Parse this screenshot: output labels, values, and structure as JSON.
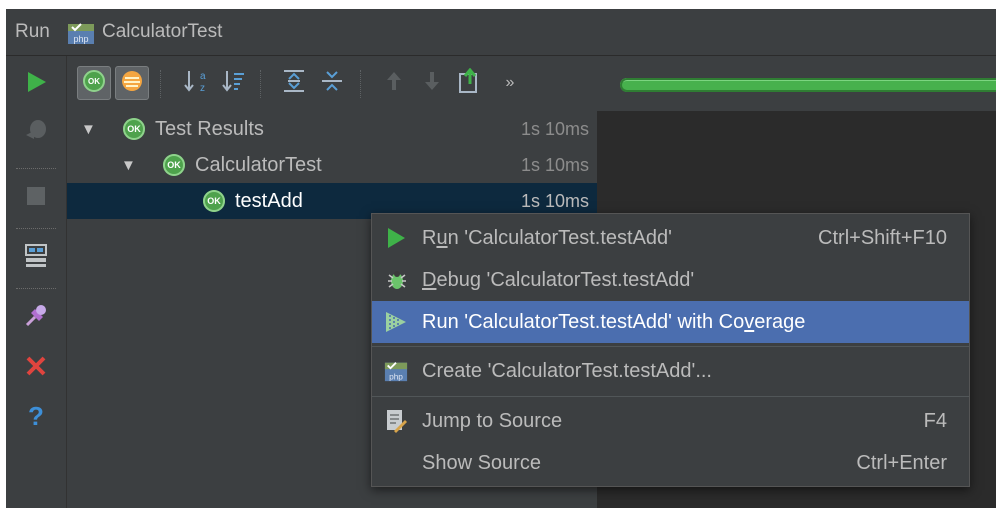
{
  "window": {
    "title_prefix": "Run",
    "title": "CalculatorTest",
    "title_icon": "php-file-icon"
  },
  "left_toolbar": [
    {
      "icon": "run-icon",
      "label": "Rerun"
    },
    {
      "icon": "debug-toggle-icon",
      "label": "Toggle auto-test"
    },
    {
      "icon": "stop-icon",
      "label": "Stop"
    },
    {
      "icon": "layout-icon",
      "label": "Restore layout"
    },
    {
      "icon": "pin-icon",
      "label": "Pin tab"
    },
    {
      "icon": "close-icon",
      "label": "Close"
    },
    {
      "icon": "help-icon",
      "label": "Help"
    }
  ],
  "top_toolbar": [
    {
      "icon": "show-passed-icon",
      "pressed": true
    },
    {
      "icon": "show-ignored-icon",
      "pressed": true
    },
    {
      "icon": "sort-alpha-icon"
    },
    {
      "icon": "sort-duration-icon"
    },
    {
      "icon": "expand-all-icon"
    },
    {
      "icon": "collapse-all-icon"
    },
    {
      "icon": "arrow-up-icon"
    },
    {
      "icon": "arrow-down-icon"
    },
    {
      "icon": "export-icon"
    },
    {
      "icon": "more-icon",
      "text": "»"
    }
  ],
  "progress": {
    "value": 1.0,
    "color": "#47b14d"
  },
  "tree": [
    {
      "label": "Test Results",
      "time": "1s 10ms",
      "level": 0,
      "expanded": true,
      "status": "OK"
    },
    {
      "label": "CalculatorTest",
      "time": "1s 10ms",
      "level": 1,
      "expanded": true,
      "status": "OK"
    },
    {
      "label": "testAdd",
      "time": "1s 10ms",
      "level": 2,
      "selected": true,
      "status": "OK"
    }
  ],
  "context_menu": {
    "items": [
      {
        "pre": "R",
        "mnemonic": "u",
        "post": "n 'CalculatorTest.testAdd'",
        "shortcut": "Ctrl+Shift+F10",
        "icon": "run-icon"
      },
      {
        "pre": "",
        "mnemonic": "D",
        "post": "ebug 'CalculatorTest.testAdd'",
        "shortcut": "",
        "icon": "debug-icon"
      },
      {
        "pre": "Run 'CalculatorTest.testAdd' with Co",
        "mnemonic": "v",
        "post": "erage",
        "shortcut": "",
        "icon": "coverage-icon",
        "highlighted": true
      },
      {
        "pre": "Create 'CalculatorTest.testAdd'...",
        "mnemonic": "",
        "post": "",
        "shortcut": "",
        "icon": "php-create-icon"
      },
      {
        "pre": "Jump to Source",
        "mnemonic": "",
        "post": "",
        "shortcut": "F4",
        "icon": "jump-to-source-icon"
      },
      {
        "pre": "Show Source",
        "mnemonic": "",
        "post": "",
        "shortcut": "Ctrl+Enter",
        "icon": ""
      }
    ]
  },
  "colors": {
    "background": "#2b2b2b",
    "panel": "#3c3f41",
    "selection": "#0d293e",
    "menu_highlight": "#4b6eaf",
    "ok_green": "#4ea24c",
    "run_green": "#3fb249",
    "close_red": "#e0443e",
    "help_blue": "#3d8fd8"
  }
}
